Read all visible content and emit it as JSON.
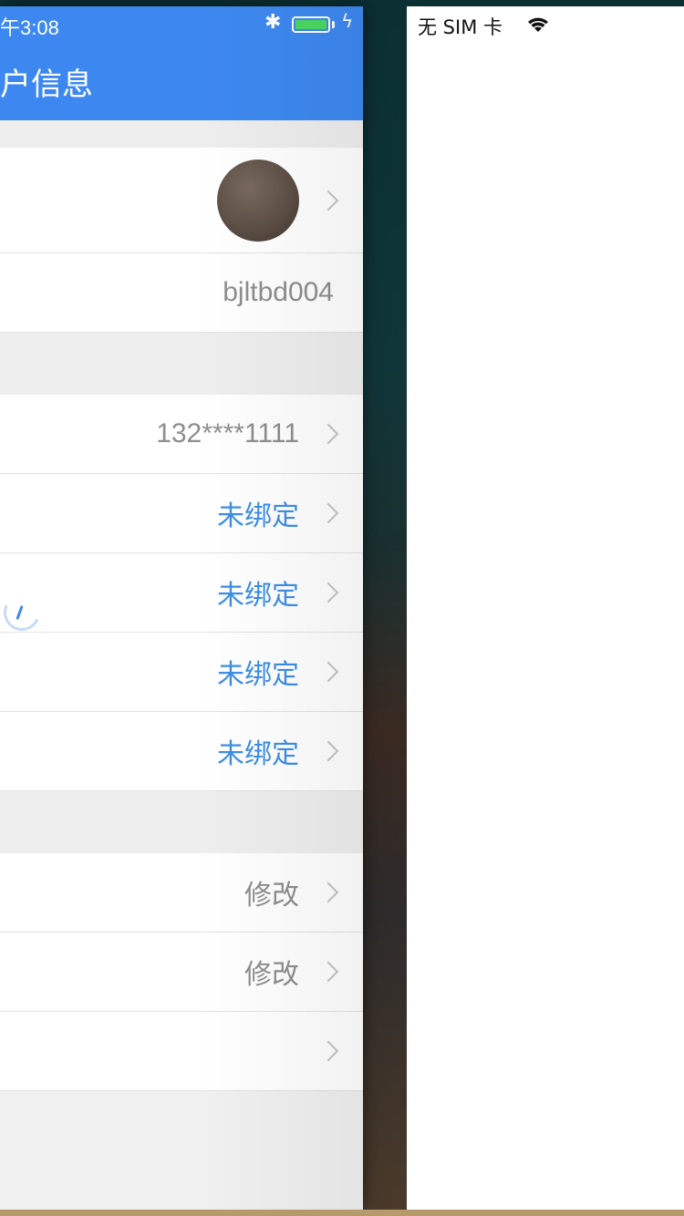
{
  "status_bar": {
    "time": "午3:08",
    "bluetooth_glyph": "✱",
    "charging_glyph": "ϟ"
  },
  "nav": {
    "title": "户信息",
    "color": "#3d88f0"
  },
  "rows": {
    "username": "bjltbd004",
    "phone": "132****1111",
    "bind_1": "未绑定",
    "bind_2": "未绑定",
    "bind_3": "未绑定",
    "bind_4": "未绑定",
    "modify_1": "修改",
    "modify_2": "修改"
  },
  "right_card": {
    "carrier": "无 SIM 卡"
  },
  "icons": {
    "avatar": "user-avatar",
    "chevron": "chevron-right-icon",
    "spinner": "loading-spinner-icon",
    "wifi": "wifi-icon",
    "bluetooth": "bluetooth-icon",
    "battery": "battery-icon"
  }
}
